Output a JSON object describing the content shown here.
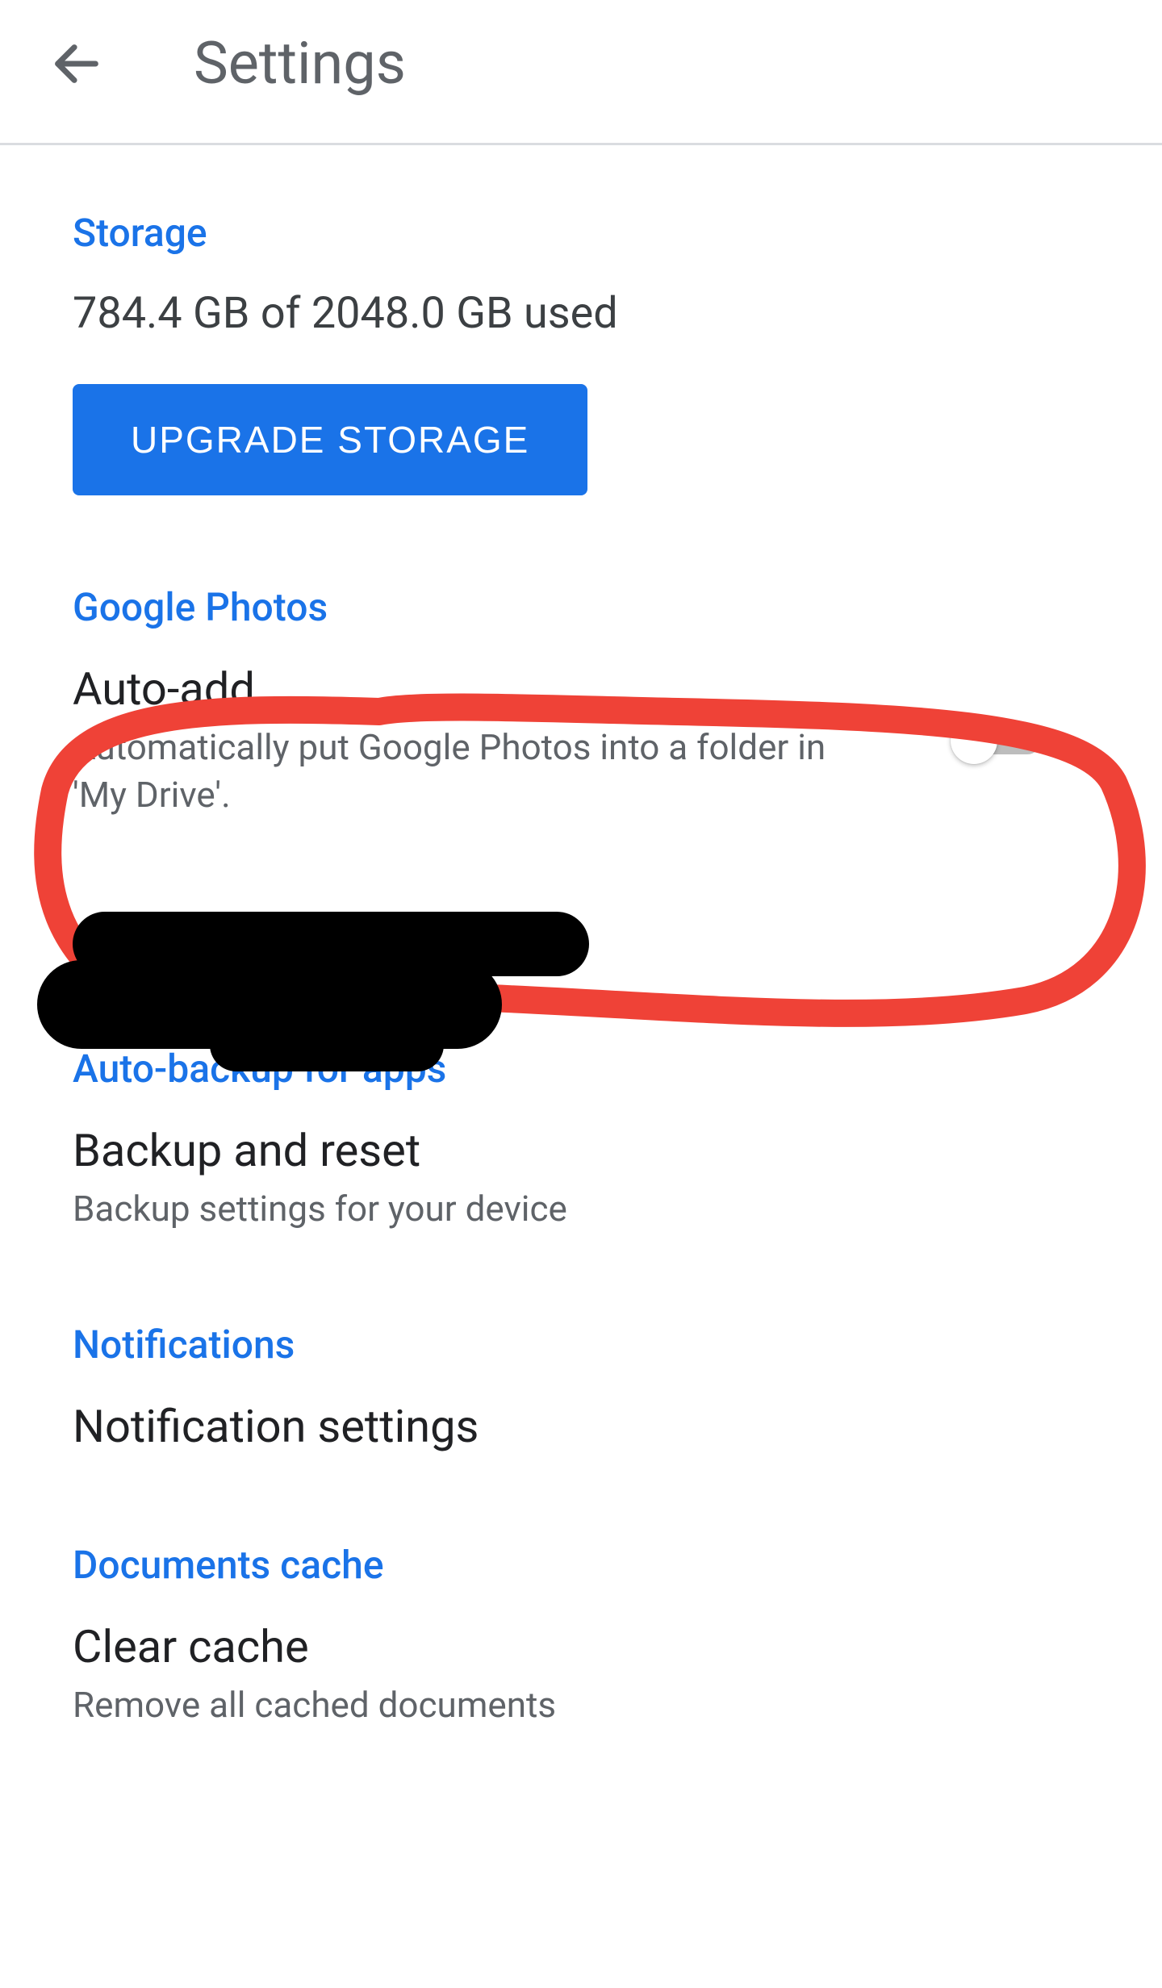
{
  "header": {
    "title": "Settings"
  },
  "storage": {
    "section_title": "Storage",
    "usage_text": "784.4 GB of 2048.0 GB used",
    "upgrade_label": "UPGRADE STORAGE"
  },
  "google_photos": {
    "section_title": "Google Photos",
    "auto_add": {
      "title": "Auto-add",
      "subtitle": "Automatically put Google Photos into a folder in 'My Drive'.",
      "toggle_state": "off"
    }
  },
  "auto_backup": {
    "section_title": "Auto-backup for apps",
    "backup_reset": {
      "title": "Backup and reset",
      "subtitle": "Backup settings for your device"
    }
  },
  "notifications": {
    "section_title": "Notifications",
    "settings": {
      "title": "Notification settings"
    }
  },
  "documents_cache": {
    "section_title": "Documents cache",
    "clear": {
      "title": "Clear cache",
      "subtitle": "Remove all cached documents"
    }
  },
  "colors": {
    "accent": "#1a73e8",
    "annotation": "#ef4237"
  }
}
